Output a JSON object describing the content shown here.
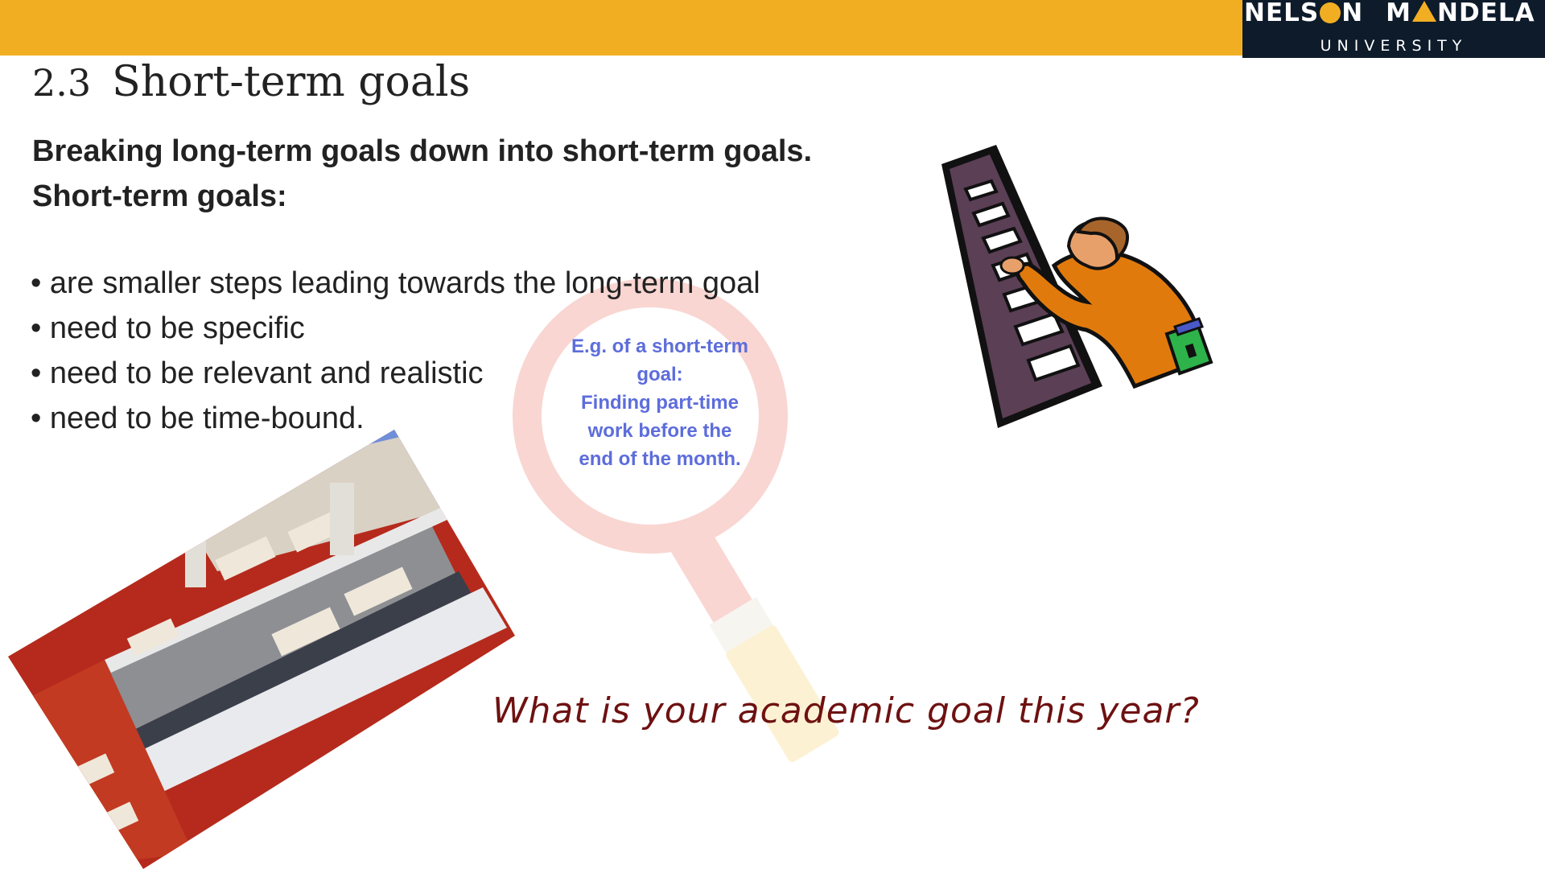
{
  "header": {
    "accent_color": "#f2ae22",
    "logo": {
      "word1": "NELSON",
      "word2": "MANDELA",
      "subtitle": "UNIVERSITY",
      "background": "#0d1b2a"
    }
  },
  "slide": {
    "number": "2.3",
    "title": "Short-term goals",
    "subheading_1": "Breaking long-term goals down into short-term goals.",
    "subheading_2": "Short-term goals:",
    "bullets": [
      "• are smaller steps leading towards the long-term goal",
      "• need to be specific",
      "• need to be relevant and realistic",
      "• need to be time-bound."
    ],
    "example_callout": {
      "lines": [
        "E.g. of a short-term",
        "goal:",
        "Finding part-time",
        "work before the",
        "end of the month."
      ],
      "color": "#5d6ddb"
    },
    "question": "What is your academic goal this year?",
    "question_color": "#6e1111"
  },
  "images": {
    "ladder_clipart": "person-climbing-ladder",
    "library_photo": "library-interior",
    "magnifier": "magnifying-glass"
  }
}
